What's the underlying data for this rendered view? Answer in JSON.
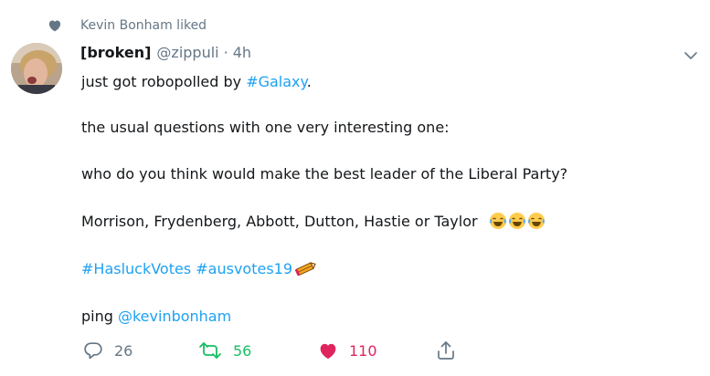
{
  "social_context": {
    "text": "Kevin Bonham liked",
    "icon": "heart-icon"
  },
  "tweet": {
    "display_name": "[broken]",
    "handle": "@zippuli",
    "separator": "·",
    "timestamp": "4h",
    "lines": {
      "l1_text": "just got robopolled by ",
      "l1_hashtag": "#Galaxy",
      "l1_end": ".",
      "l2": "the usual questions with one very interesting one:",
      "l3": "who do you think would make the best leader of the Liberal Party?",
      "l4": "Morrison, Frydenberg, Abbott, Dutton, Hastie or Taylor",
      "l5_tag1": "#HasluckVotes",
      "l5_tag2": "#ausvotes19",
      "l6_text": "ping ",
      "l6_mention": "@kevinbonham"
    },
    "emojis": [
      "face-with-tears-of-joy",
      "face-with-tears-of-joy",
      "face-with-tears-of-joy"
    ],
    "hashtag_emoji": "ausvotes-pencil-hashflag"
  },
  "actions": {
    "reply_count": "26",
    "retweet_count": "56",
    "like_count": "110"
  },
  "colors": {
    "link": "#1da1f2",
    "secondary": "#657786",
    "retweet": "#17bf63",
    "like": "#e0245e"
  }
}
